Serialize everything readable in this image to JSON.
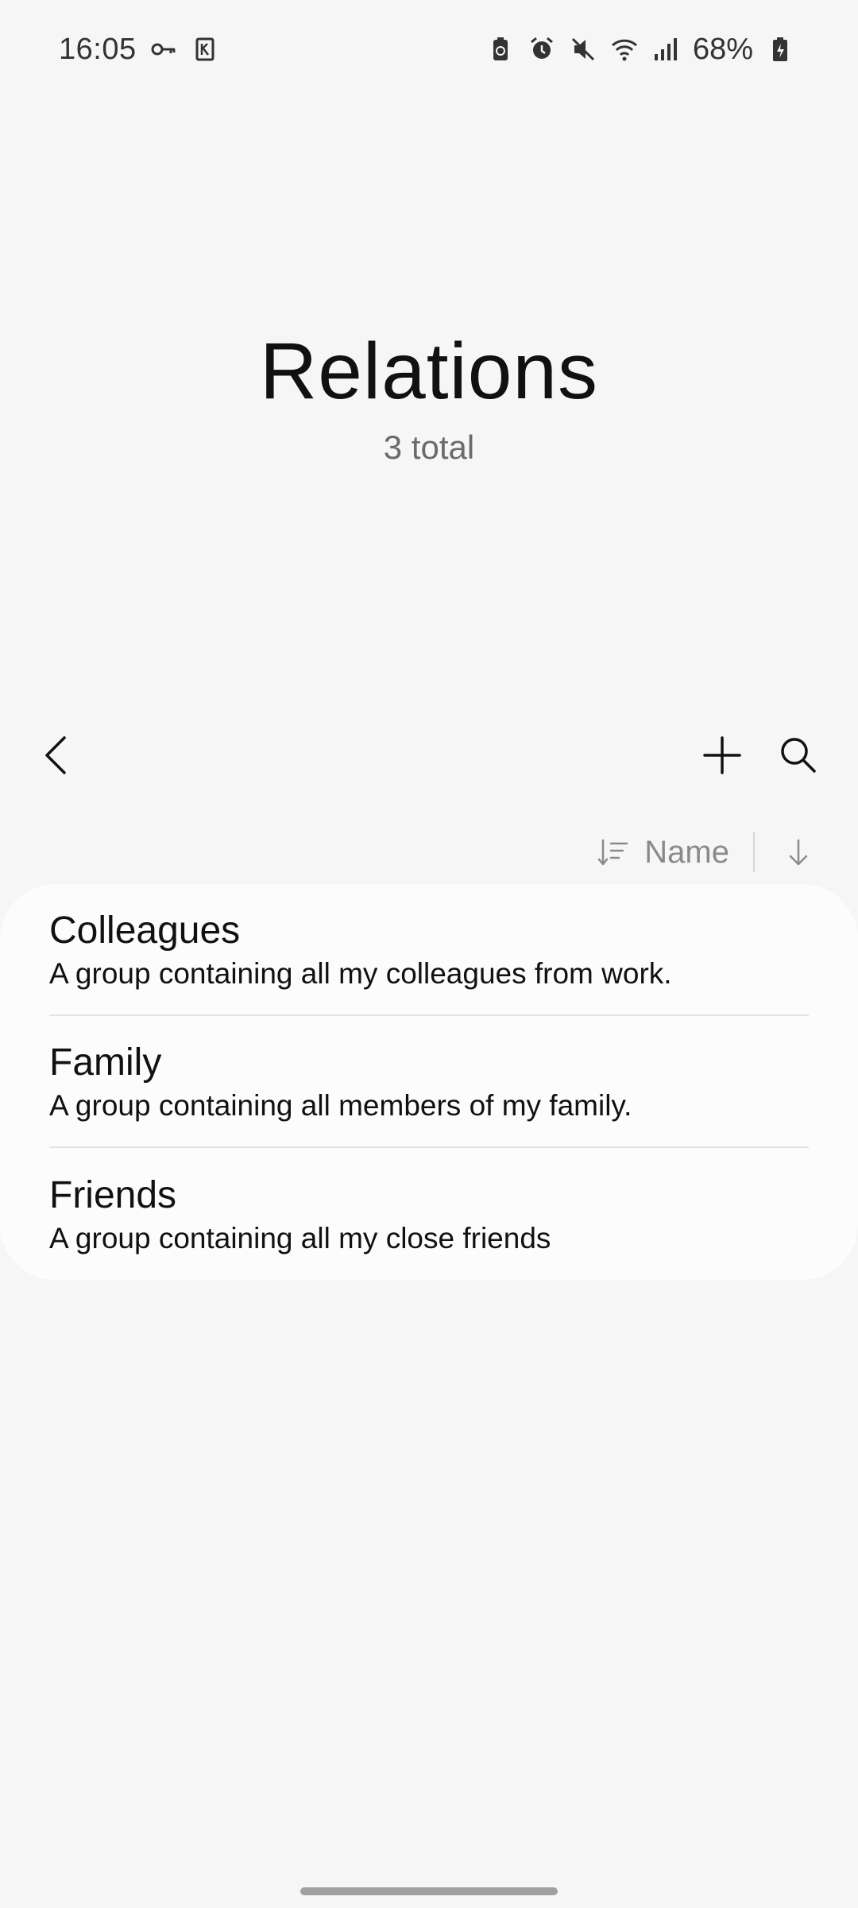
{
  "status_bar": {
    "time": "16:05",
    "battery_percent": "68%",
    "left_icons": [
      "key-icon",
      "app-notification-icon"
    ],
    "right_icons": [
      "battery-saver-icon",
      "alarm-icon",
      "mute-icon",
      "wifi-icon",
      "signal-icon",
      "battery-icon"
    ]
  },
  "header": {
    "title": "Relations",
    "subtitle": "3 total"
  },
  "toolbar": {
    "back_icon": "chevron-left-icon",
    "add_icon": "plus-icon",
    "search_icon": "search-icon"
  },
  "sort": {
    "label": "Name",
    "field_icon": "sort-icon",
    "direction_icon": "arrow-down-icon"
  },
  "groups": [
    {
      "name": "Colleagues",
      "description": "A group containing all my colleagues from work."
    },
    {
      "name": "Family",
      "description": "A group containing all members of my family."
    },
    {
      "name": "Friends",
      "description": "A group containing all my close friends"
    }
  ],
  "colors": {
    "background": "#f6f6f6",
    "card": "#fcfcfc",
    "text_primary": "#111111",
    "text_secondary": "#6b6b6b",
    "divider": "#e4e4e4"
  }
}
